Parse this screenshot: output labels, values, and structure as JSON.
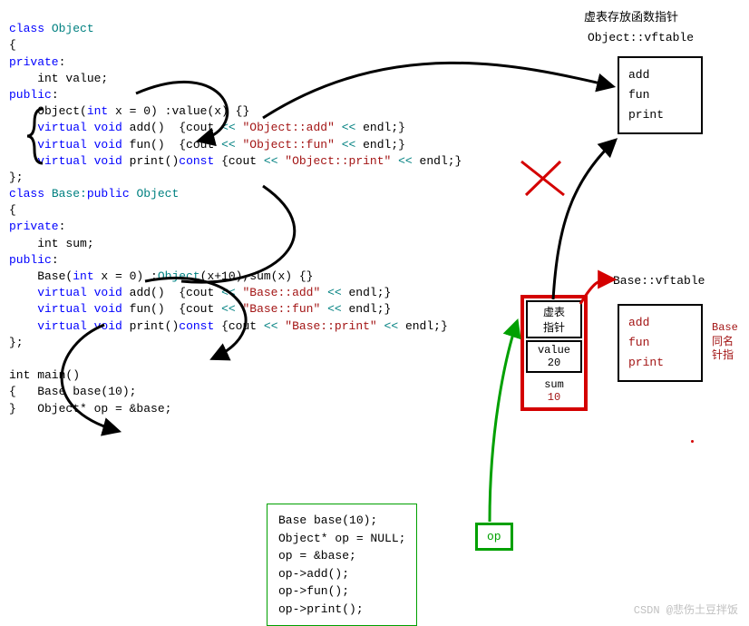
{
  "header": {
    "title_cn": "虚表存放函数指针",
    "obj_vftable_label": "Object::vftable",
    "base_vftable_label": "Base::vftable"
  },
  "obj_vftable": {
    "f1": "add",
    "f2": "fun",
    "f3": "print"
  },
  "base_vftable": {
    "f1": "add",
    "f2": "fun",
    "f3": "print"
  },
  "red_note": {
    "l1": "Base",
    "l2": "同名",
    "l3": "针指"
  },
  "object_layout": {
    "vptr_label": "虚表\n指针",
    "value_label": "value",
    "value_val": "20",
    "sum_label": "sum",
    "sum_val": "10"
  },
  "op_label": "op",
  "main_box": {
    "l1": "Base base(10);",
    "l2": "Object* op = NULL;",
    "l3": "op = &base;",
    "l4": "op->add();",
    "l5": "op->fun();",
    "l6": "op->print();"
  },
  "watermark": "CSDN @悲伤土豆拌饭",
  "code": {
    "class_object": "class",
    "object_name": " Object",
    "open": "{",
    "private": "private",
    "int_value": "    int value;",
    "public": "public",
    "obj_ctor_1": "    Object(",
    "obj_ctor_2": " x = 0) :value(x) {}",
    "virtual": "    virtual",
    "void": " void",
    "add_sig": " add()  {cout ",
    "fun_sig": " fun()  {cout ",
    "shl": "<<",
    "obj_add_str": " \"Object::add\" ",
    "obj_fun_str": " \"Object::fun\" ",
    "obj_print_str": " \"Object::print\" ",
    "print_sig": " print()",
    "const": "const",
    "endl": " endl;}",
    "close": "};",
    "class_base": "class",
    "base_name": " Base:",
    "base_public": "public",
    "base_obj": " Object",
    "int_sum": "    int sum;",
    "base_ctor_1": "    Base(",
    "base_ctor_2": " x = 0) :",
    "base_ctor_obj": "Object",
    "base_ctor_3": "(x+10),sum(x) {}",
    "base_add_str": " \"Base::add\" ",
    "base_fun_str": " \"Base::fun\" ",
    "base_print_str": " \"Base::print\" ",
    "int_main": "int main()",
    "main_open": "{   Base base(10);",
    "main_op": "}   Object* op = &base;",
    "cout_before": " {cout "
  }
}
